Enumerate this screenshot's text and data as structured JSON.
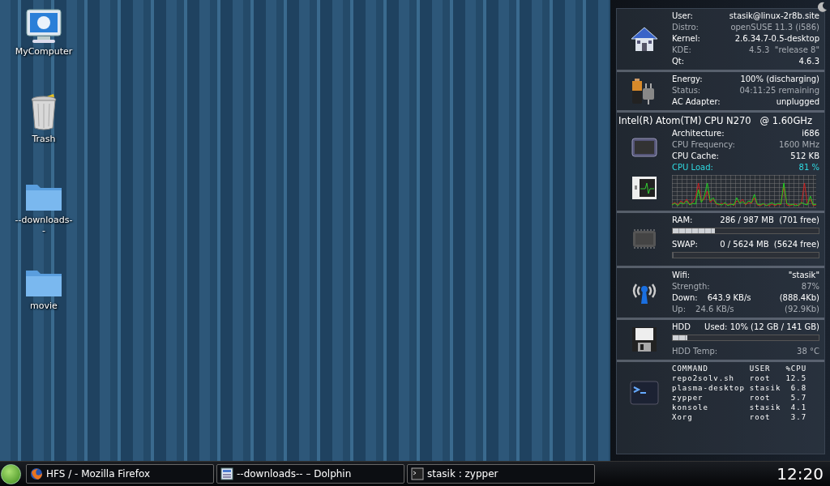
{
  "desktop_icons": [
    {
      "label": "MyComputer",
      "kind": "computer"
    },
    {
      "label": "Trash",
      "kind": "trash"
    },
    {
      "label": "--downloads--",
      "kind": "folder"
    },
    {
      "label": "movie",
      "kind": "folder"
    }
  ],
  "system_monitor": {
    "sections": [
      {
        "kind": "system",
        "rows": [
          {
            "label": "User:",
            "value": "stasik@linux-2r8b.site",
            "kind": "normal"
          },
          {
            "label": "Distro:",
            "value": "openSUSE 11.3 (i586)",
            "kind": "dim"
          },
          {
            "label": "Kernel:",
            "value": "2.6.34.7-0.5-desktop",
            "kind": "normal"
          },
          {
            "label": "KDE:",
            "value": "4.5.3  \"release 8\"",
            "kind": "dim"
          },
          {
            "label": "Qt:",
            "value": "4.6.3",
            "kind": "normal"
          }
        ]
      },
      {
        "kind": "power",
        "rows": [
          {
            "label": "Energy:",
            "value": "100% (discharging)",
            "kind": "normal"
          },
          {
            "label": "Status:",
            "value": "04:11:25 remaining",
            "kind": "dim"
          },
          {
            "label": "AC Adapter:",
            "value": "unplugged",
            "kind": "normal"
          }
        ]
      },
      {
        "kind": "cpu",
        "title": "Intel(R) Atom(TM) CPU N270   @ 1.60GHz",
        "rows": [
          {
            "label": "Architecture:",
            "value": "i686",
            "kind": "normal"
          },
          {
            "label": "CPU Frequency:",
            "value": "1600 MHz",
            "kind": "dim"
          },
          {
            "label": "CPU Cache:",
            "value": "512 KB",
            "kind": "normal"
          },
          {
            "label": "CPU Load:",
            "value": "81 %",
            "kind": "accent"
          }
        ]
      },
      {
        "kind": "memory",
        "bars": [
          {
            "label": "RAM:",
            "value": "286 / 987 MB  (701 free)",
            "level": 0.29
          },
          {
            "label": "SWAP:",
            "value": "0 / 5624 MB  (5624 free)",
            "level": 0
          }
        ]
      },
      {
        "kind": "network",
        "rows": [
          {
            "label": "Wifi:",
            "value": "\"stasik\"",
            "kind": "normal"
          },
          {
            "label": "Strength:",
            "value": "87%",
            "kind": "dim"
          },
          {
            "label": "Down:",
            "middle": "643.9 KB/s",
            "value": "(888.4Kb)",
            "kind": "normal"
          },
          {
            "label": "Up:",
            "middle": "24.6 KB/s",
            "value": "(92.9Kb)",
            "kind": "dim"
          }
        ]
      },
      {
        "kind": "disk",
        "bars": [
          {
            "label": "HDD",
            "value": "Used: 10% (12 GB / 141 GB)",
            "level": 0.1
          }
        ],
        "rows": [
          {
            "label": "HDD Temp:",
            "value": "38 °C",
            "kind": "dim"
          }
        ]
      },
      {
        "kind": "processes",
        "columns": [
          "COMMAND",
          "USER",
          "%CPU"
        ],
        "rows": [
          [
            "repo2solv.sh",
            "root",
            "12.5"
          ],
          [
            "plasma-desktop",
            "stasik",
            "6.8"
          ],
          [
            "zypper",
            "root",
            "5.7"
          ],
          [
            "konsole",
            "stasik",
            "4.1"
          ],
          [
            "Xorg",
            "root",
            "3.7"
          ]
        ]
      }
    ]
  },
  "taskbar": {
    "tasks": [
      {
        "label": "HFS / - Mozilla Firefox",
        "kind": "browser"
      },
      {
        "label": "--downloads-- – Dolphin",
        "kind": "file-manager"
      },
      {
        "label": "stasik : zypper",
        "kind": "terminal"
      }
    ],
    "clock": "12:20"
  }
}
